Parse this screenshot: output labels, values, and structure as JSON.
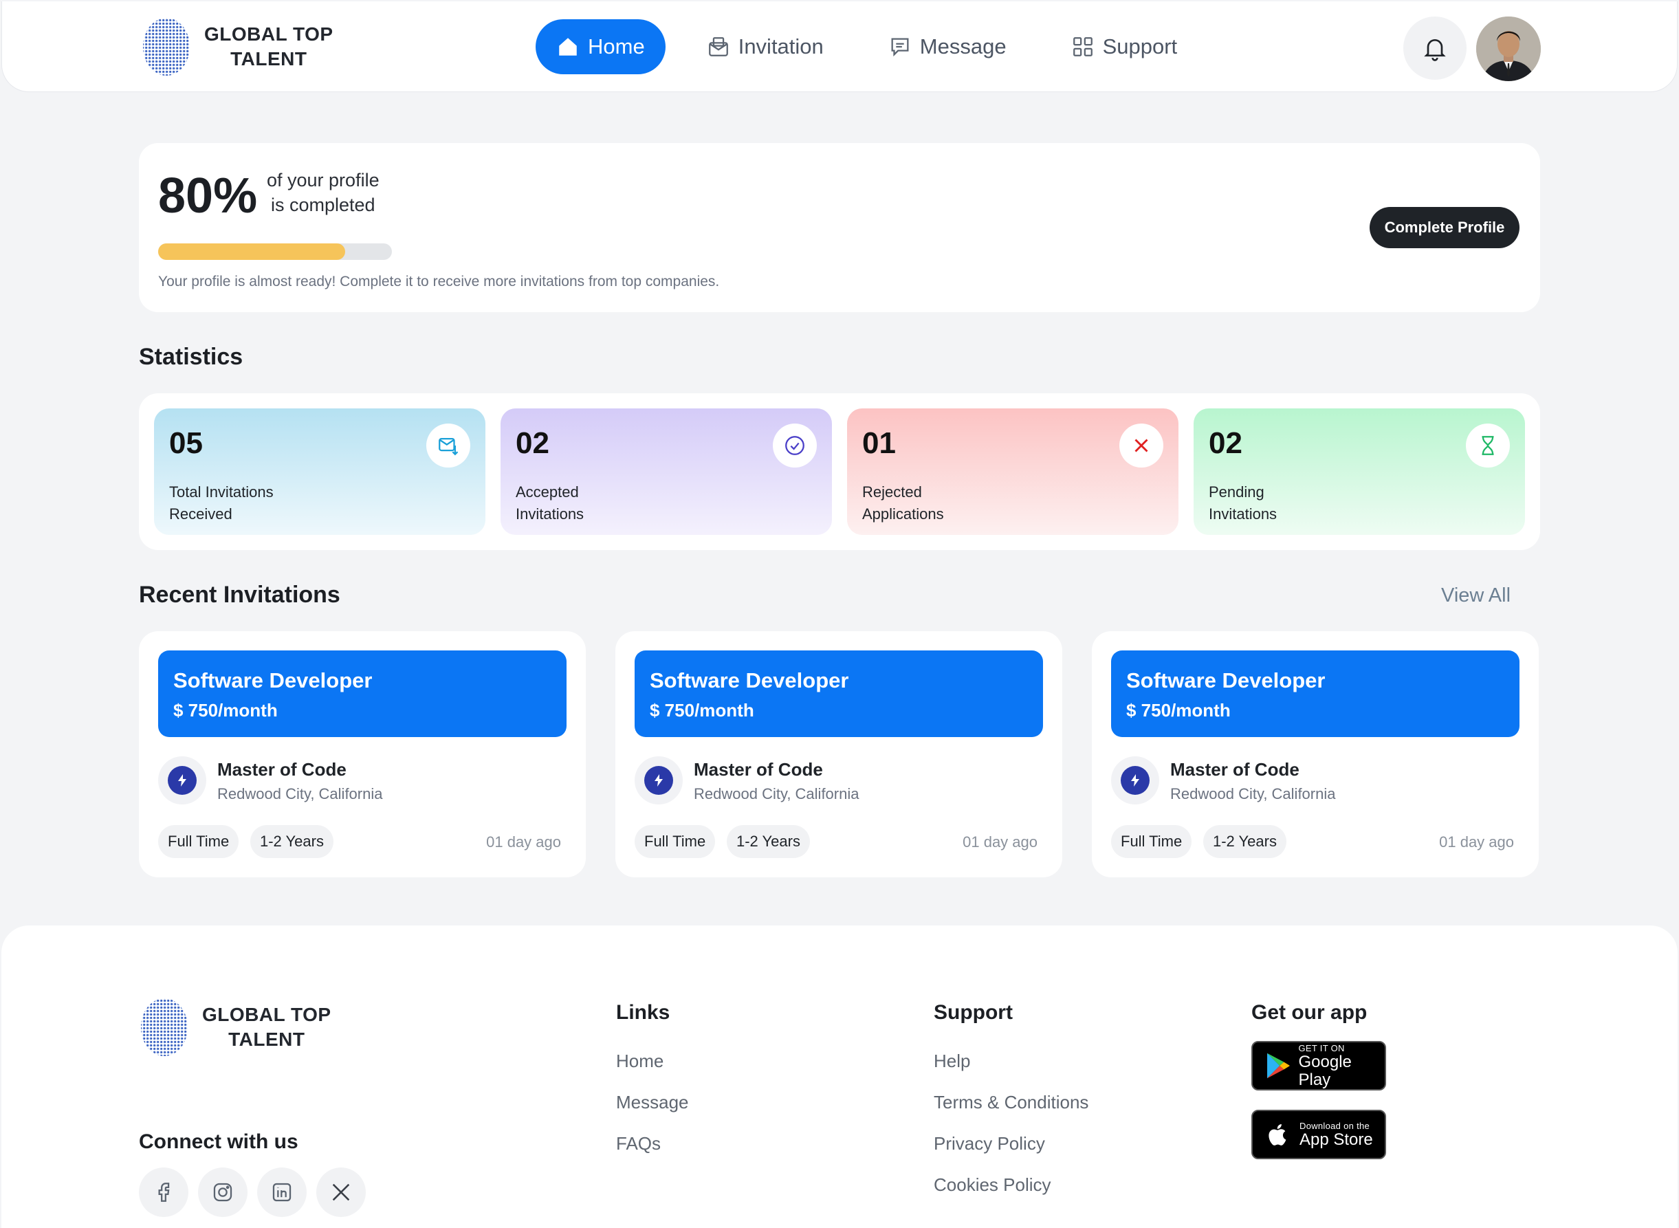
{
  "brand": {
    "line1": "GLOBAL TOP",
    "line2": "TALENT"
  },
  "nav": [
    {
      "label": "Home",
      "icon": "home-icon",
      "active": true
    },
    {
      "label": "Invitation",
      "icon": "invitation-icon",
      "active": false
    },
    {
      "label": "Message",
      "icon": "message-icon",
      "active": false
    },
    {
      "label": "Support",
      "icon": "grid-icon",
      "active": false
    }
  ],
  "profile": {
    "percent": "80%",
    "percent_text_1": "of your profile",
    "percent_text_2": "is completed",
    "progress": 0.8,
    "note": "Your profile is almost ready! Complete it to receive more invitations from top companies.",
    "button": "Complete Profile"
  },
  "statistics": {
    "title": "Statistics",
    "items": [
      {
        "value": "05",
        "label1": "Total Invitations",
        "label2": "Received",
        "icon": "mail-download-icon"
      },
      {
        "value": "02",
        "label1": "Accepted",
        "label2": "Invitations",
        "icon": "check-circle-icon"
      },
      {
        "value": "01",
        "label1": "Rejected",
        "label2": "Applications",
        "icon": "close-icon"
      },
      {
        "value": "02",
        "label1": "Pending",
        "label2": "Invitations",
        "icon": "hourglass-icon"
      }
    ]
  },
  "recent": {
    "title": "Recent Invitations",
    "view_all": "View All",
    "cards": [
      {
        "title": "Software Developer",
        "salary": "$ 750/month",
        "company": "Master of Code",
        "location": "Redwood City, California",
        "tag1": "Full Time",
        "tag2": "1-2 Years",
        "posted": "01 day ago"
      },
      {
        "title": "Software Developer",
        "salary": "$ 750/month",
        "company": "Master of Code",
        "location": "Redwood City, California",
        "tag1": "Full Time",
        "tag2": "1-2 Years",
        "posted": "01 day ago"
      },
      {
        "title": "Software Developer",
        "salary": "$ 750/month",
        "company": "Master of Code",
        "location": "Redwood City, California",
        "tag1": "Full Time",
        "tag2": "1-2 Years",
        "posted": "01 day ago"
      }
    ]
  },
  "footer": {
    "connect": "Connect with us",
    "links_title": "Links",
    "links": [
      "Home",
      "Message",
      "FAQs"
    ],
    "support_title": "Support",
    "support": [
      "Help",
      "Terms & Conditions",
      "Privacy Policy",
      "Cookies Policy"
    ],
    "app_title": "Get our app",
    "google_small": "GET IT ON",
    "google_big": "Google Play",
    "apple_small": "Download on the",
    "apple_big": "App Store",
    "socials": [
      "facebook-icon",
      "instagram-icon",
      "linkedin-icon",
      "x-icon"
    ]
  },
  "colors": {
    "primary": "#0b76f4",
    "progress": "#f6c45a",
    "dark_button": "#1f2328"
  }
}
